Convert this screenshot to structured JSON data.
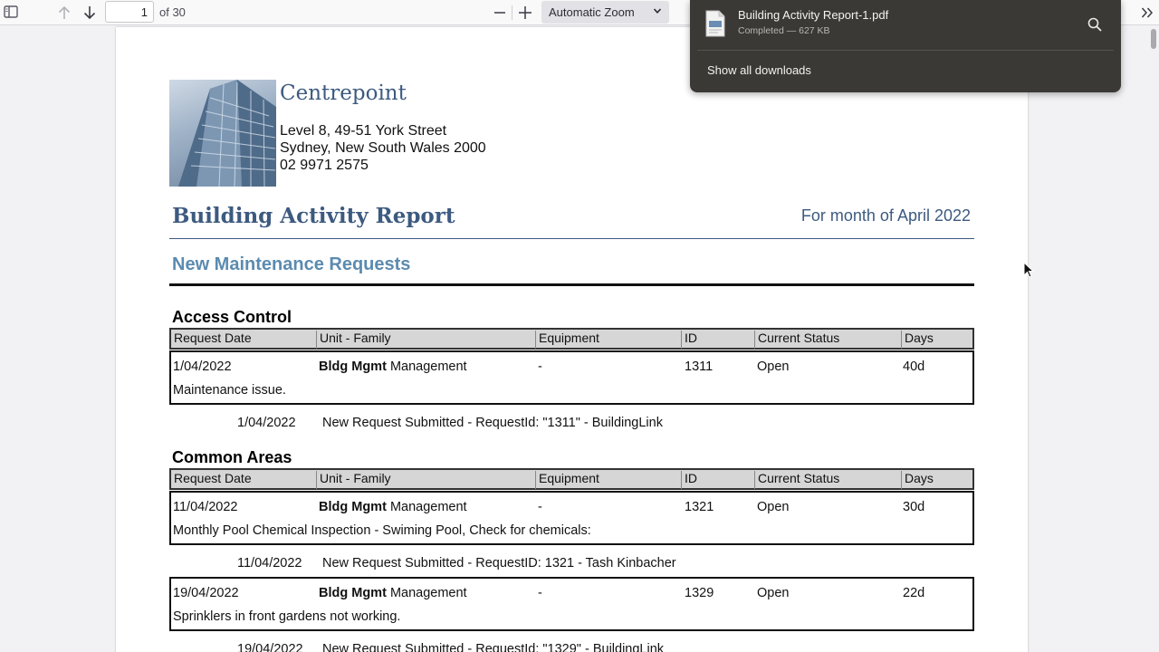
{
  "toolbar": {
    "page_number": "1",
    "page_total": "of 30",
    "zoom": "Automatic Zoom"
  },
  "downloads": {
    "file_name": "Building Activity Report-1.pdf",
    "status": "Completed — 627 KB",
    "show_all": "Show all downloads"
  },
  "document": {
    "company": "Centrepoint",
    "address": [
      "Level 8, 49-51 York Street",
      "Sydney, New South Wales 2000",
      "02 9971 2575"
    ],
    "title": "Building Activity Report",
    "month": "For month of April 2022",
    "section": "New Maintenance Requests",
    "columns": [
      "Request Date",
      "Unit - Family",
      "Equipment",
      "ID",
      "Current Status",
      "Days"
    ],
    "categories": [
      {
        "name": "Access Control",
        "records": [
          {
            "date": "1/04/2022",
            "unit_bold": "Bldg Mgmt",
            "unit": "Management",
            "equipment": "-",
            "id": "1311",
            "status": "Open",
            "days": "40d",
            "description": "Maintenance issue.",
            "note_date": "1/04/2022",
            "note": "New Request Submitted - RequestId: \"1311\" - BuildingLink"
          }
        ]
      },
      {
        "name": "Common Areas",
        "records": [
          {
            "date": "11/04/2022",
            "unit_bold": "Bldg Mgmt",
            "unit": "Management",
            "equipment": "-",
            "id": "1321",
            "status": "Open",
            "days": "30d",
            "description": "Monthly Pool Chemical Inspection - Swiming Pool, Check for chemicals:",
            "note_date": "11/04/2022",
            "note": "New Request Submitted - RequestID: 1321 - Tash Kinbacher"
          },
          {
            "date": "19/04/2022",
            "unit_bold": "Bldg Mgmt",
            "unit": "Management",
            "equipment": "-",
            "id": "1329",
            "status": "Open",
            "days": "22d",
            "description": "Sprinklers in front gardens not working.",
            "note_date": "19/04/2022",
            "note": "New Request Submitted - RequestId: \"1329\" - BuildingLink"
          }
        ]
      }
    ]
  }
}
